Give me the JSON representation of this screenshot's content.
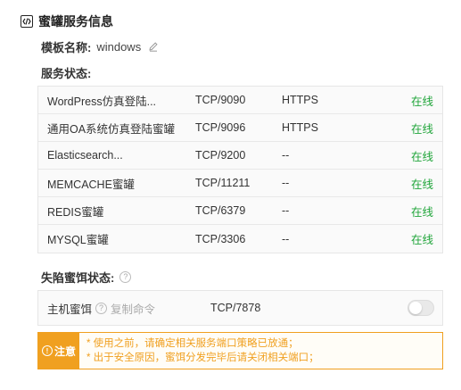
{
  "header": {
    "title": "蜜罐服务信息",
    "icon": "code-icon"
  },
  "template": {
    "label": "模板名称:",
    "value": "windows",
    "edit_icon": "pencil-icon"
  },
  "status_label": "服务状态:",
  "services": [
    {
      "name": "WordPress仿真登陆...",
      "port": "TCP/9090",
      "protocol": "HTTPS",
      "status": "在线"
    },
    {
      "name": "通用OA系统仿真登陆蜜罐",
      "port": "TCP/9096",
      "protocol": "HTTPS",
      "status": "在线"
    },
    {
      "name": "Elasticsearch...",
      "port": "TCP/9200",
      "protocol": "--",
      "status": "在线"
    },
    {
      "name": "MEMCACHE蜜罐",
      "port": "TCP/11211",
      "protocol": "--",
      "status": "在线"
    },
    {
      "name": "REDIS蜜罐",
      "port": "TCP/6379",
      "protocol": "--",
      "status": "在线"
    },
    {
      "name": "MYSQL蜜罐",
      "port": "TCP/3306",
      "protocol": "--",
      "status": "在线"
    }
  ],
  "trap": {
    "label": "失陷蜜饵状态:",
    "name": "主机蜜饵",
    "copy_label": "复制命令",
    "port": "TCP/7878",
    "toggle_on": false
  },
  "notice": {
    "tag": "注意",
    "lines": [
      "* 使用之前，请确定相关服务端口策略已放通；",
      "* 出于安全原因，蜜饵分发完毕后请关闭相关端口；"
    ]
  },
  "colors": {
    "online": "#20a53a",
    "warning": "#f0a020",
    "border": "#e6e6e6"
  }
}
